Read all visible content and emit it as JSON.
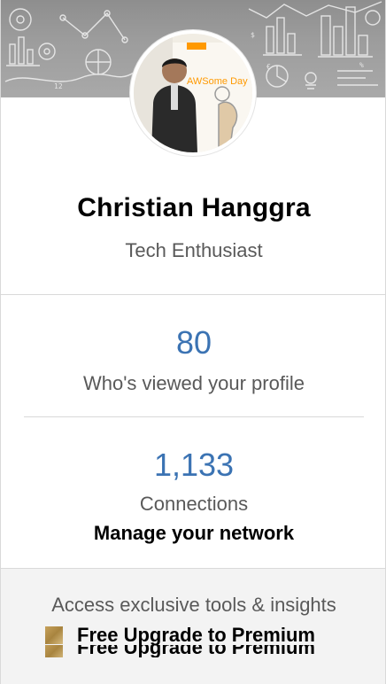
{
  "profile": {
    "name": "Christian Hanggra",
    "headline": "Tech Enthusiast",
    "avatar_badge_text": "AWSome Day"
  },
  "stats": {
    "views_count": "80",
    "views_label": "Who's viewed your profile",
    "connections_count": "1,133",
    "connections_label": "Connections",
    "manage_label": "Manage your network"
  },
  "premium": {
    "text": "Access exclusive tools & insights",
    "upgrade_label": "Free Upgrade to Premium"
  },
  "colors": {
    "link_blue": "#3b73b3",
    "premium_gold": "#c6a15b"
  }
}
